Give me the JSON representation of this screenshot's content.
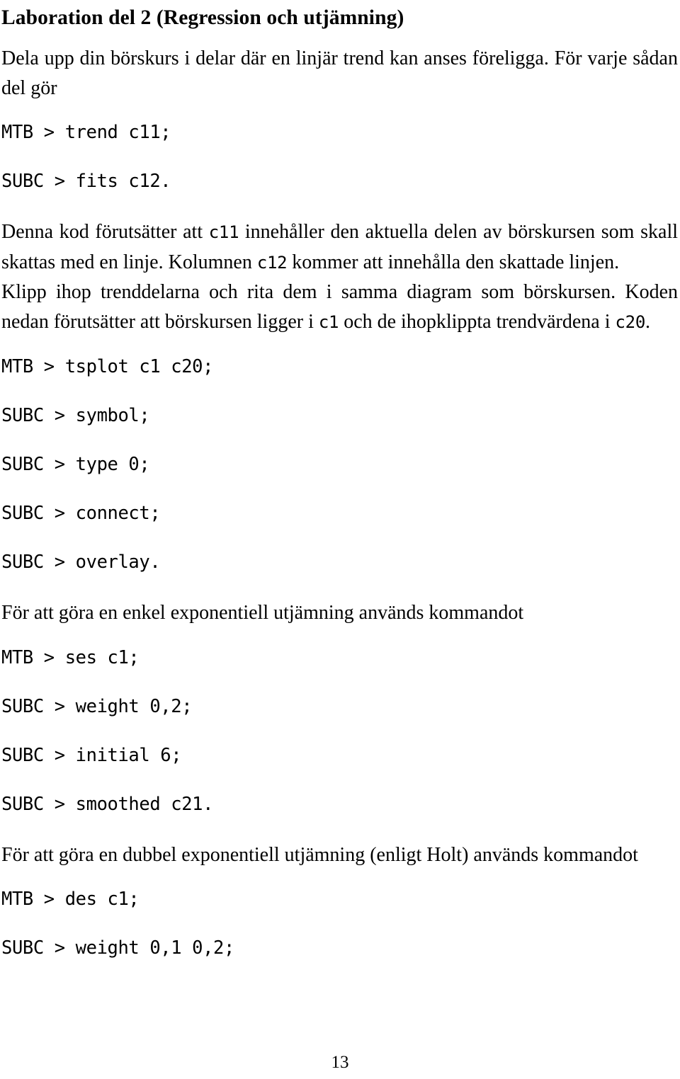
{
  "document": {
    "title": "Laboration del 2 (Regression och utjämning)",
    "page_number": "13",
    "language": "sv"
  },
  "blocks": {
    "para_1": "Dela upp din börskurs i delar där en linjär trend kan anses föreligga. För varje sådan del gör",
    "cmd_trend": "MTB > trend c11;",
    "cmd_fits": "SUBC > fits c12.",
    "para_2_a": "Denna kod förutsätter att ",
    "para_2_code1": "c11",
    "para_2_b": " innehåller den aktuella delen av börskursen som skall skattas med en linje. Kolumnen ",
    "para_2_code2": "c12",
    "para_2_c": " kommer att innehålla den skattade linjen.",
    "para_3_a": "Klipp ihop trenddelarna och rita dem i samma diagram som börskursen. Koden nedan förutsätter att börskursen ligger i ",
    "para_3_code1": "c1",
    "para_3_b": " och de ihopklippta trendvärdena i ",
    "para_3_code2": "c20",
    "para_3_c": ".",
    "cmd_tsplot": "MTB > tsplot c1 c20;",
    "cmd_symbol": "SUBC > symbol;",
    "cmd_type": "SUBC > type 0;",
    "cmd_connect": "SUBC > connect;",
    "cmd_overlay": "SUBC > overlay.",
    "para_4": "För att göra en enkel exponentiell utjämning används kommandot",
    "cmd_ses": "MTB > ses c1;",
    "cmd_weight_ses": "SUBC > weight 0,2;",
    "cmd_initial": "SUBC > initial 6;",
    "cmd_smoothed": "SUBC > smoothed c21.",
    "para_5": "För att göra en dubbel exponentiell utjämning (enligt Holt) används komman­dot",
    "cmd_des": "MTB > des c1;",
    "cmd_weight_des": "SUBC > weight 0,1 0,2;"
  },
  "colors": {
    "page_background": "#ffffff",
    "text": "#000000"
  }
}
